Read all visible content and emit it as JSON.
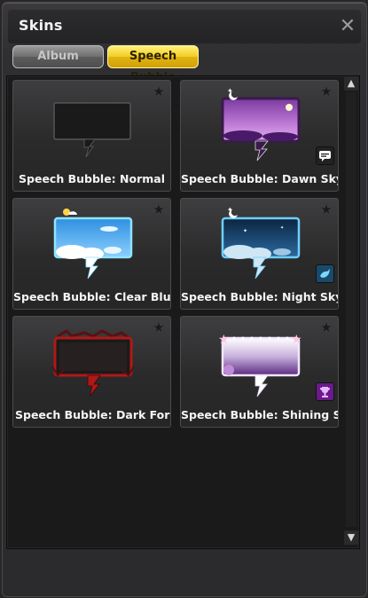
{
  "window": {
    "title": "Skins",
    "close_icon": "close-icon"
  },
  "tabs": [
    {
      "label": "Album",
      "selected": false
    },
    {
      "label": "Speech Bubble",
      "selected": true
    }
  ],
  "skins": [
    {
      "label": "Speech Bubble: Normal",
      "badge": null
    },
    {
      "label": "Speech Bubble: Dawn Sky",
      "badge": "chat-icon"
    },
    {
      "label": "Speech Bubble: Clear Blue",
      "badge": null
    },
    {
      "label": "Speech Bubble: Night Sky",
      "badge": "whale-icon"
    },
    {
      "label": "Speech Bubble: Dark Force",
      "badge": null
    },
    {
      "label": "Speech Bubble: Shining Sta",
      "badge": "trophy-icon"
    }
  ],
  "colors": {
    "selected_tab": "#f2cc22",
    "dawn_sky": "#b066c8",
    "clear_blue": "#3aa7ef",
    "night_sky": "#17426a",
    "dark_force": "#b01818",
    "shining_star": "#7a4a9c"
  }
}
